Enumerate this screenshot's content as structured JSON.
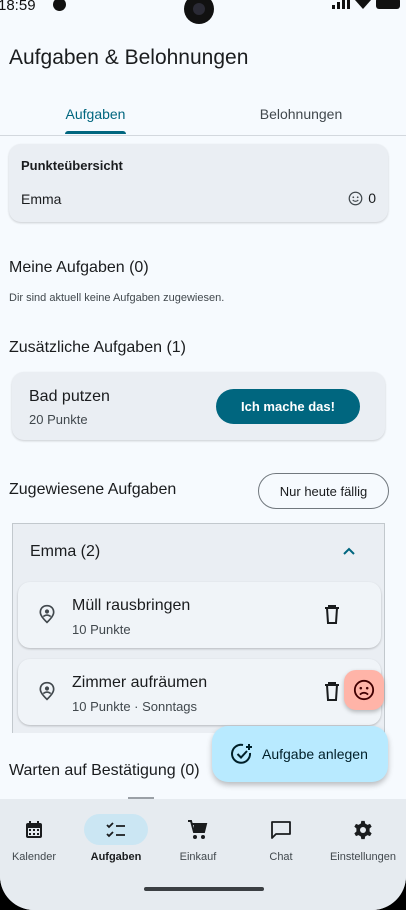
{
  "status_bar": {
    "time": "18:59"
  },
  "app": {
    "title": "Aufgaben & Belohnungen"
  },
  "tabs": [
    {
      "label": "Aufgaben",
      "active": true
    },
    {
      "label": "Belohnungen",
      "active": false
    }
  ],
  "points": {
    "title": "Punkteübersicht",
    "name": "Emma",
    "score": "0"
  },
  "my_tasks": {
    "title": "Meine Aufgaben (0)",
    "empty_hint": "Dir sind aktuell keine Aufgaben zugewiesen."
  },
  "extra_tasks": {
    "title": "Zusätzliche Aufgaben (1)",
    "items": [
      {
        "name": "Bad putzen",
        "points": "20 Punkte",
        "action": "Ich mache das!"
      }
    ]
  },
  "assigned": {
    "title": "Zugewiesene Aufgaben",
    "filter_label": "Nur heute fällig",
    "group": {
      "name": "Emma (2)",
      "items": [
        {
          "name": "Müll rausbringen",
          "meta": "10 Punkte"
        },
        {
          "name": "Zimmer aufräumen",
          "meta": "10 Punkte · Sonntags"
        }
      ]
    }
  },
  "pending": {
    "title": "Warten auf Bestätigung (0)"
  },
  "fab": {
    "label": "Aufgabe anlegen"
  },
  "nav": [
    {
      "label": "Kalender",
      "icon": "calendar-icon",
      "active": false
    },
    {
      "label": "Aufgaben",
      "icon": "checklist-icon",
      "active": true
    },
    {
      "label": "Einkauf",
      "icon": "cart-icon",
      "active": false
    },
    {
      "label": "Chat",
      "icon": "chat-icon",
      "active": false
    },
    {
      "label": "Einstellungen",
      "icon": "gear-icon",
      "active": false
    }
  ],
  "colors": {
    "primary": "#00667f",
    "background": "#f6fafe",
    "card": "#eaeef3",
    "fab": "#b8eaff",
    "error_container": "#ffb4a8"
  }
}
